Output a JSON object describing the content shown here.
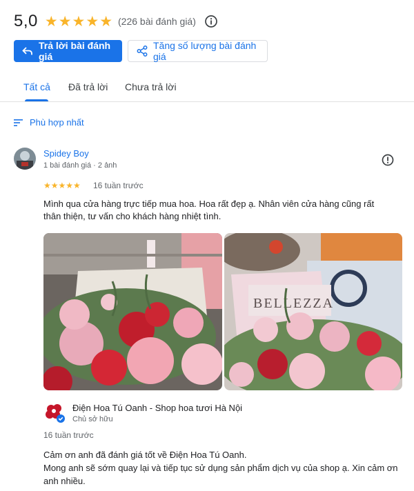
{
  "summary": {
    "rating": "5,0",
    "star_count": 5,
    "review_count": "(226 bài đánh giá)",
    "star_color": "#f9b42a"
  },
  "actions": {
    "reply_label": "Trả lời bài đánh giá",
    "increase_label": "Tăng số lượng bài đánh giá"
  },
  "tabs": [
    {
      "label": "Tất cả",
      "active": true
    },
    {
      "label": "Đã trả lời",
      "active": false
    },
    {
      "label": "Chưa trả lời",
      "active": false
    }
  ],
  "sort": {
    "label": "Phù hợp nhất"
  },
  "review": {
    "name": "Spidey Boy",
    "meta": "1 bài đánh giá · 2 ảnh",
    "stars": "★★★★★",
    "time": "16 tuần trước",
    "text": "Mình qua cửa hàng trực tiếp mua hoa. Hoa rất đẹp ạ. Nhân viên cửa hàng cũng rất thân thiện, tư vấn cho khách hàng nhiệt tình.",
    "photo_sign_text": "BELLEZZA"
  },
  "owner_reply": {
    "name": "Điện Hoa Tú Oanh - Shop hoa tươi Hà Nội",
    "role": "Chủ sở hữu",
    "time": "16 tuần trước",
    "line1": "Cảm ơn anh đã đánh giá tốt về Điện Hoa Tú Oanh.",
    "line2": "Mong anh sẽ sớm quay lại và tiếp tục sử dụng sản phẩm dịch vụ của shop ạ. Xin cảm ơn anh nhiều."
  },
  "colors": {
    "accent": "#1a73e8",
    "text": "#202124",
    "muted": "#5f6368"
  }
}
